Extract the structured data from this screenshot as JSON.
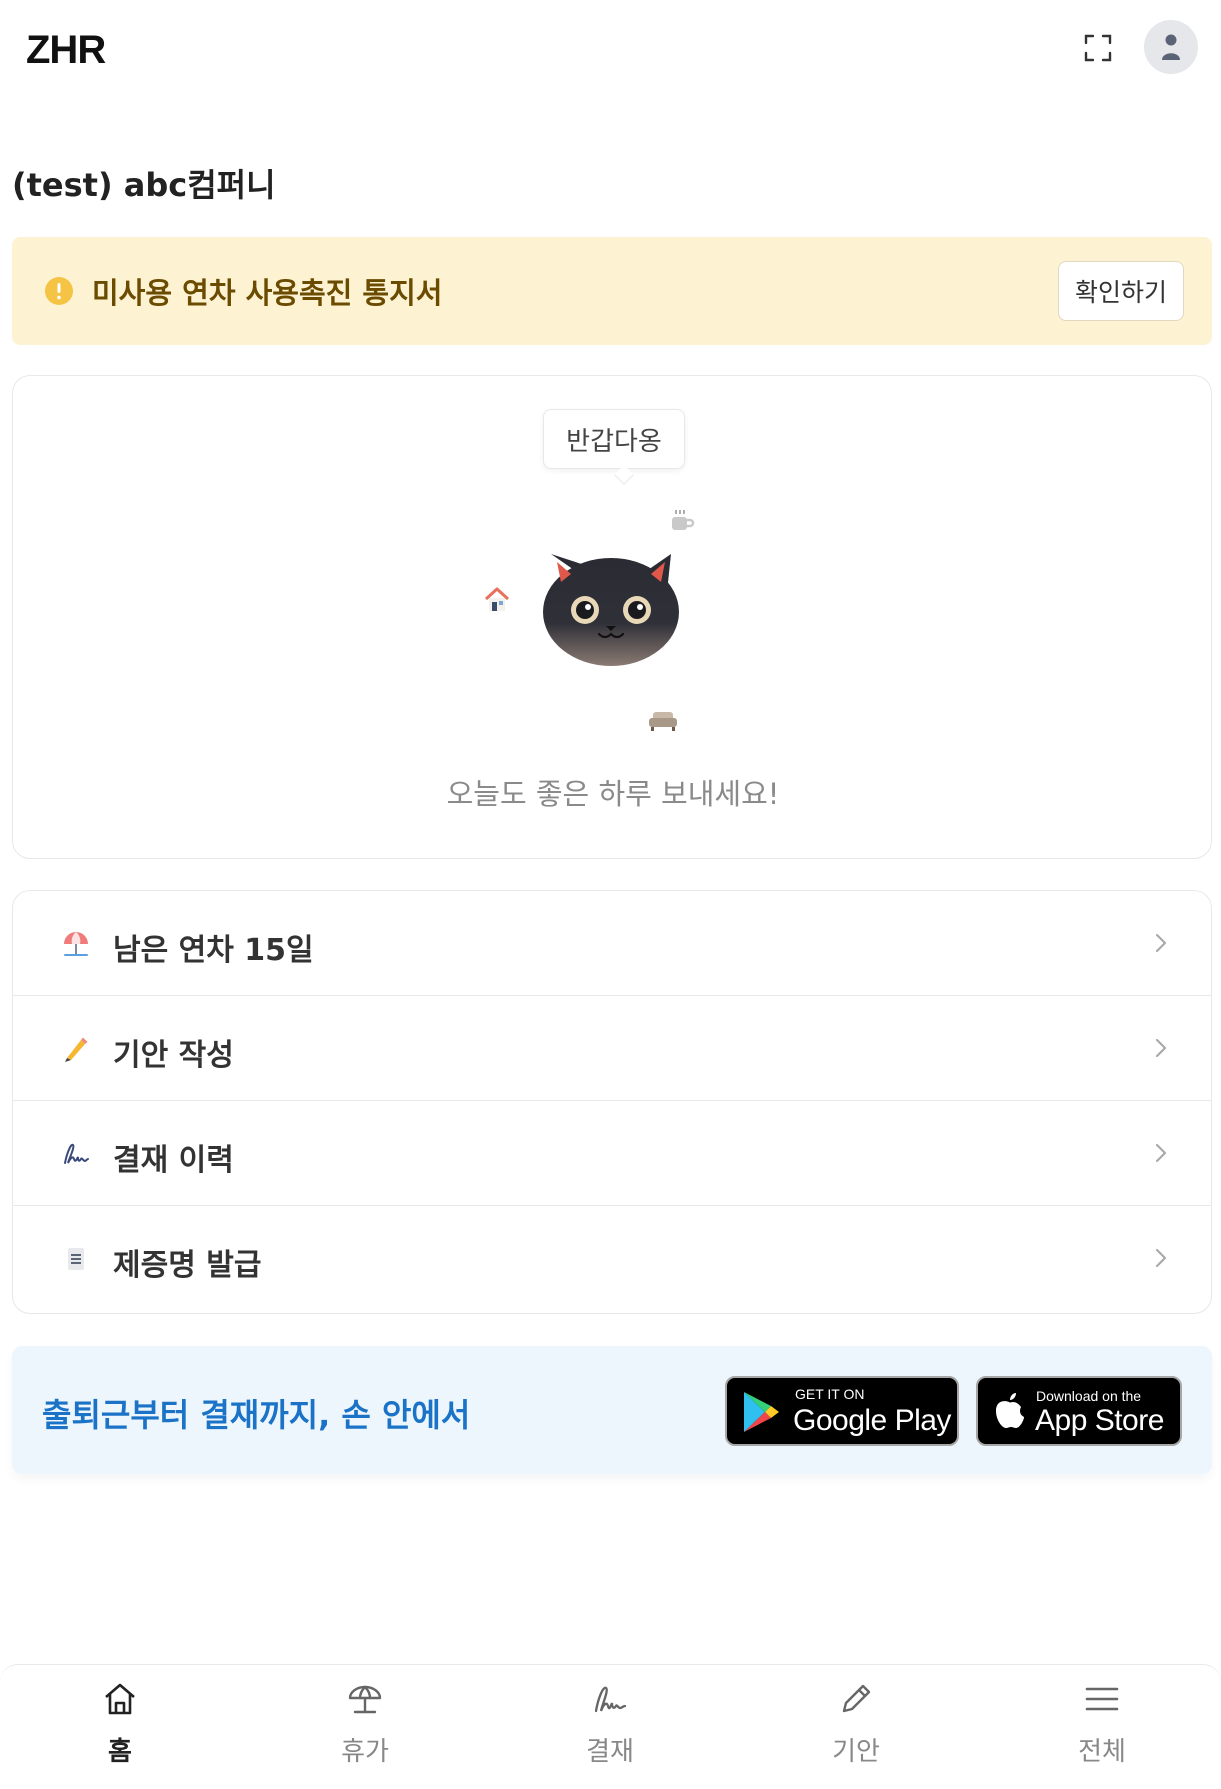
{
  "header": {
    "logo": "ZHR",
    "company": "(test) abc컴퍼니"
  },
  "notice": {
    "text": "미사용 연차 사용촉진 통지서",
    "button": "확인하기",
    "color": "#fdf3d3"
  },
  "greeting": {
    "bubble": "반갑다옹",
    "message": "오늘도 좋은 하루 보내세요!"
  },
  "menu": {
    "items": [
      {
        "icon": "beach-umbrella-icon",
        "label": "남은 연차 15일"
      },
      {
        "icon": "pencil-icon",
        "label": "기안 작성"
      },
      {
        "icon": "signature-icon",
        "label": "결재 이력"
      },
      {
        "icon": "document-icon",
        "label": "제증명 발급"
      }
    ]
  },
  "promo": {
    "text": "출퇴근부터 결재까지, 손 안에서",
    "google_small": "GET IT ON",
    "google_big": "Google Play",
    "apple_small": "Download on the",
    "apple_big": "App Store"
  },
  "nav": {
    "items": [
      {
        "label": "홈",
        "icon": "home-icon",
        "active": true
      },
      {
        "label": "휴가",
        "icon": "umbrella-icon",
        "active": false
      },
      {
        "label": "결재",
        "icon": "signature-icon",
        "active": false
      },
      {
        "label": "기안",
        "icon": "pencil-icon",
        "active": false
      },
      {
        "label": "전체",
        "icon": "menu-icon",
        "active": false
      }
    ]
  },
  "colors": {
    "accent": "#1a73c7",
    "notice_text": "#6b4b00",
    "warning_icon": "#f6c445"
  }
}
